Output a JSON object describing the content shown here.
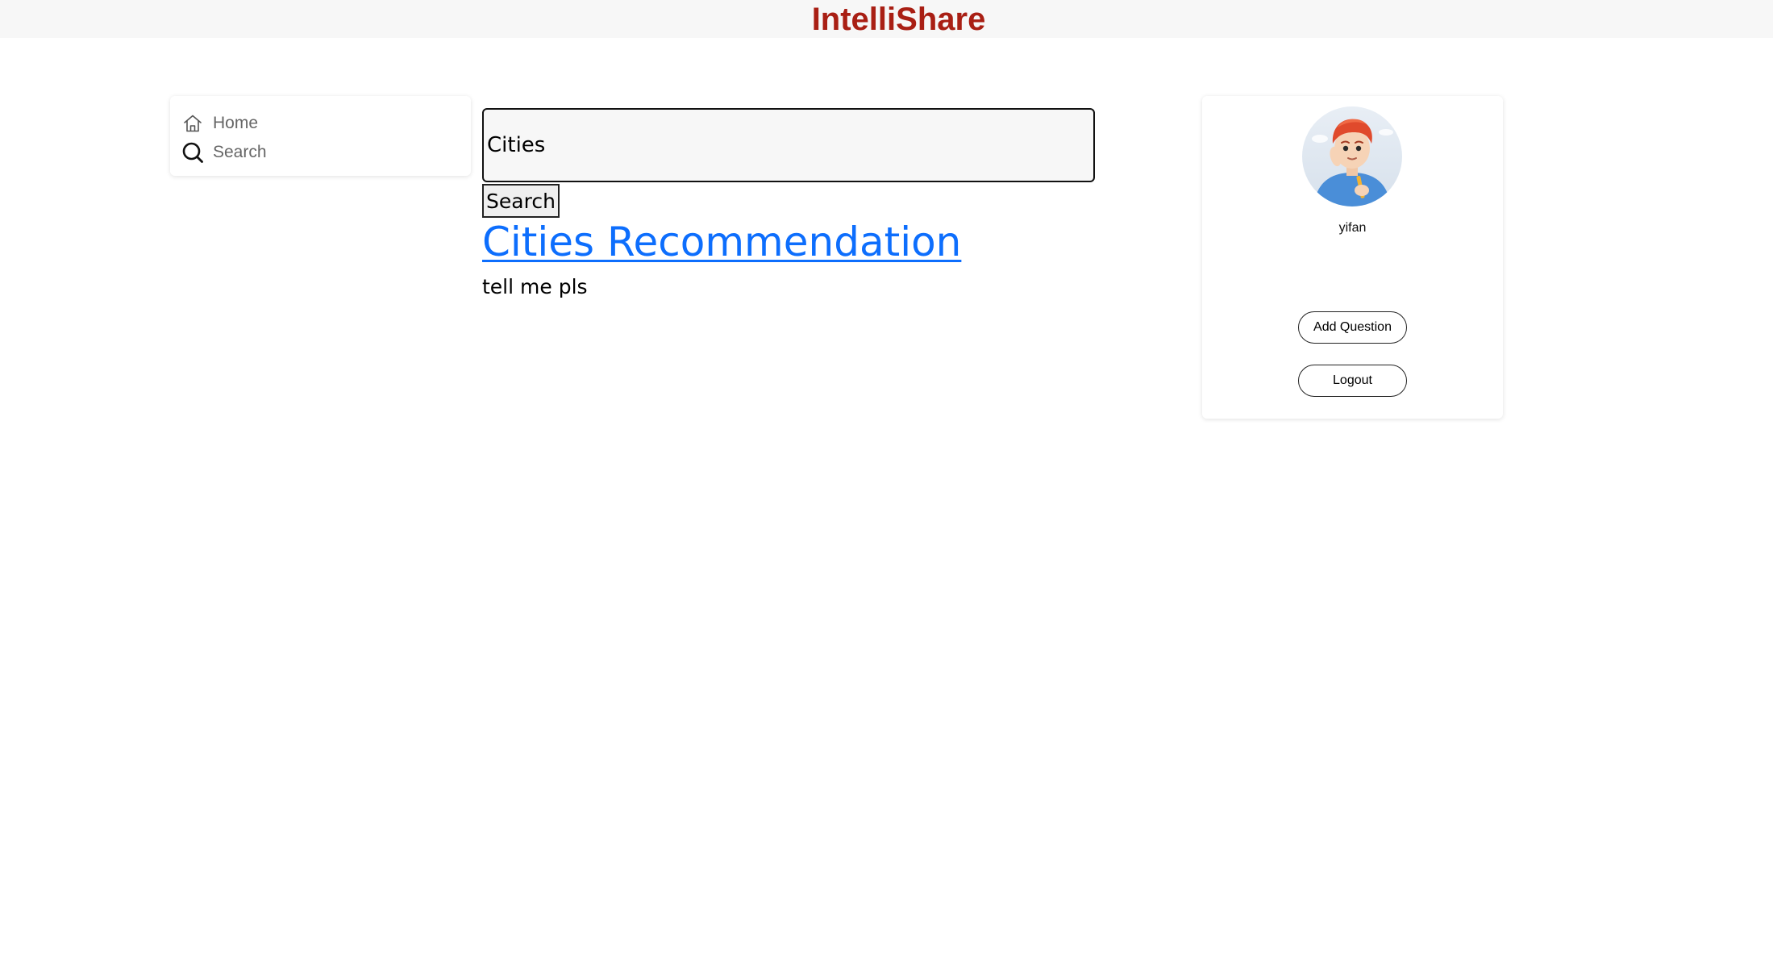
{
  "header": {
    "brand": "IntelliShare",
    "brand_color": "#a91f14"
  },
  "sidebar": {
    "items": [
      {
        "label": "Home",
        "icon": "home-icon"
      },
      {
        "label": "Search",
        "icon": "search-icon"
      }
    ]
  },
  "search": {
    "value": "Cities",
    "button_label": "Search"
  },
  "results": [
    {
      "title": "Cities Recommendation",
      "description": "tell me pls",
      "link_color": "#0d6efd"
    }
  ],
  "profile": {
    "username": "yifan",
    "avatar": "avatar-illustration",
    "add_question_label": "Add Question",
    "logout_label": "Logout"
  }
}
